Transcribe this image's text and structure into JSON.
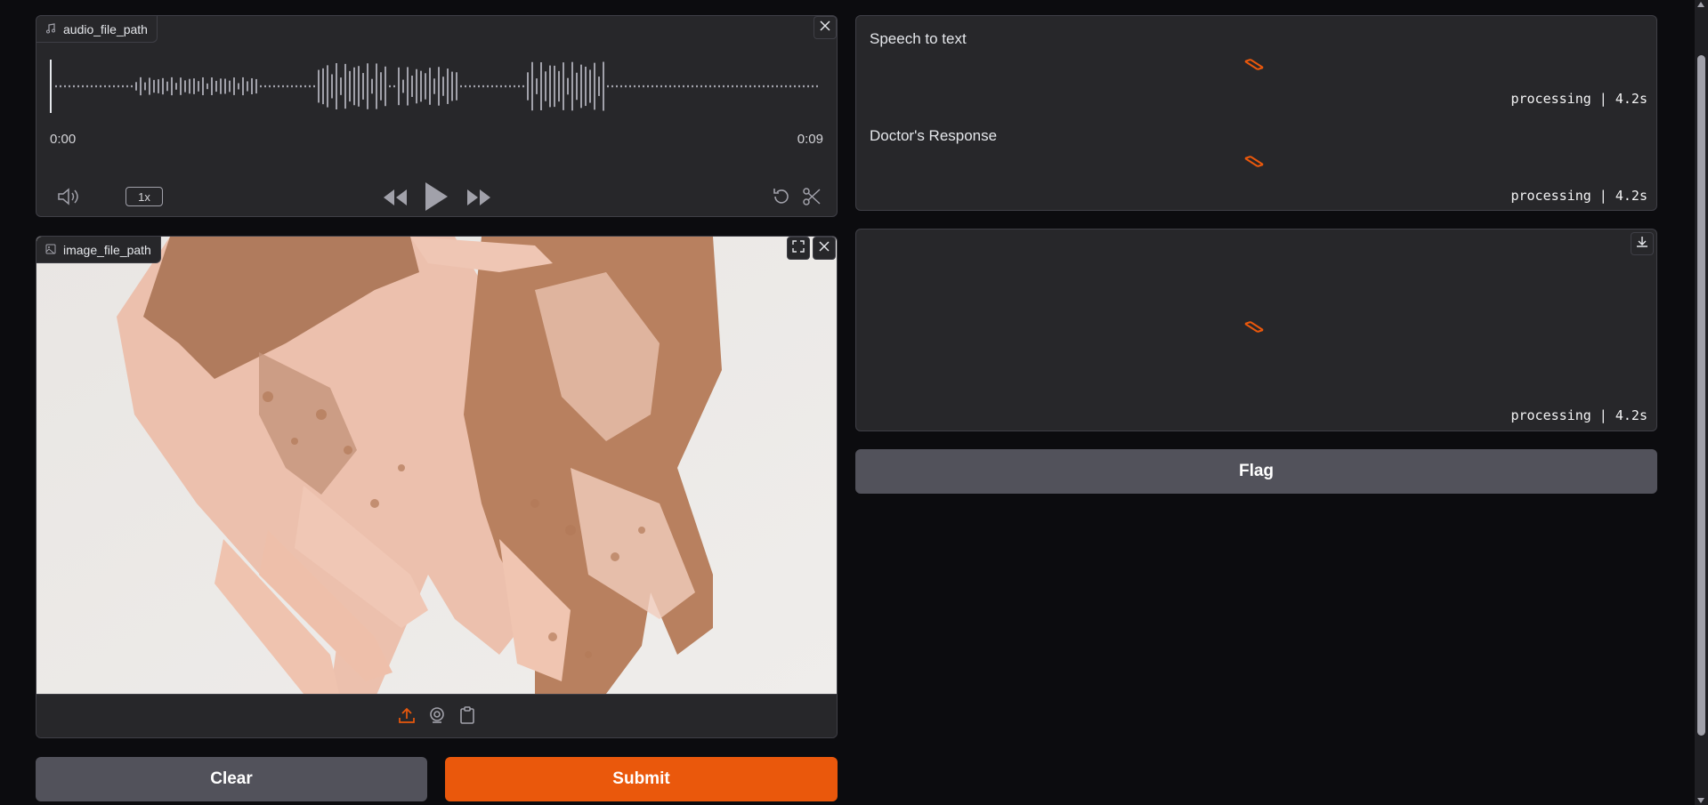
{
  "audio": {
    "label": "audio_file_path",
    "time_start": "0:00",
    "time_end": "0:09",
    "speed": "1x",
    "icons": [
      "music-icon",
      "close-icon",
      "volume-icon",
      "rewind-icon",
      "play-icon",
      "forward-icon",
      "undo-icon",
      "trim-icon"
    ]
  },
  "image": {
    "label": "image_file_path",
    "alt": "hands with vitiligo pigmentation"
  },
  "outputs": {
    "speech_label": "Speech to text",
    "speech_status": "processing | 4.2s",
    "doctor_label": "Doctor's Response",
    "doctor_status": "processing | 4.2s",
    "audio_status": "processing | 4.2s"
  },
  "buttons": {
    "flag": "Flag",
    "clear": "Clear",
    "submit": "Submit"
  },
  "colors": {
    "accent": "#ea580c",
    "panel": "#27272a",
    "secondary_button": "#52525b"
  }
}
